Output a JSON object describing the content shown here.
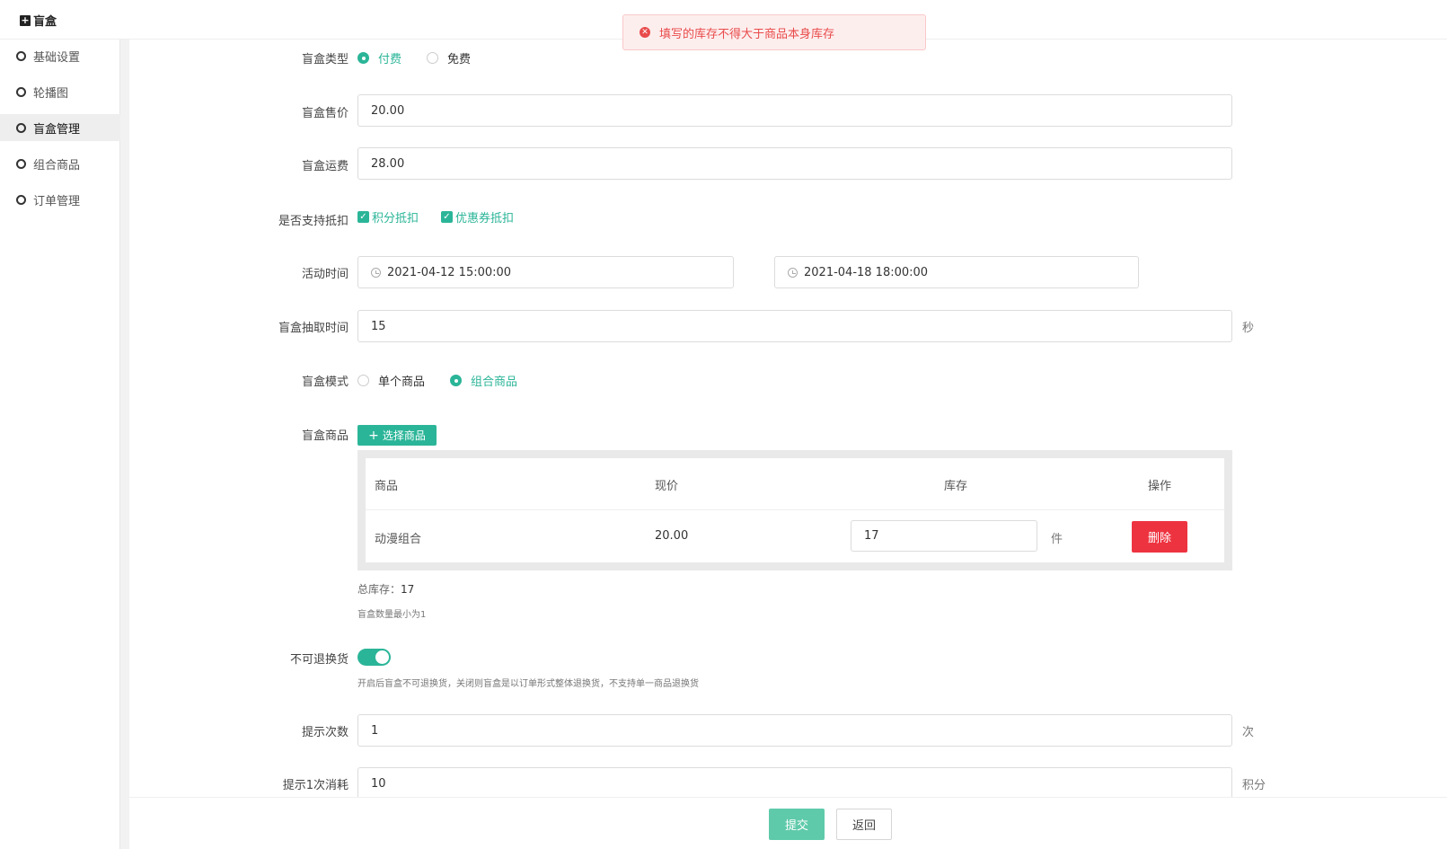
{
  "app": {
    "title": "盲盒"
  },
  "alert": {
    "message": "填写的库存不得大于商品本身库存",
    "color": "#e94b4b"
  },
  "sidebar": {
    "items": [
      {
        "label": "基础设置"
      },
      {
        "label": "轮播图"
      },
      {
        "label": "盲盒管理",
        "active": true
      },
      {
        "label": "组合商品"
      },
      {
        "label": "订单管理"
      }
    ]
  },
  "form": {
    "type": {
      "label": "盲盒类型",
      "options": [
        "付费",
        "免费"
      ],
      "selected": "付费"
    },
    "price": {
      "label": "盲盒售价",
      "value": "20.00"
    },
    "shipping": {
      "label": "盲盒运费",
      "value": "28.00"
    },
    "deduction": {
      "label": "是否支持抵扣",
      "options": [
        "积分抵扣",
        "优惠券抵扣"
      ]
    },
    "activity": {
      "label": "活动时间",
      "start": "2021-04-12 15:00:00",
      "end": "2021-04-18 18:00:00"
    },
    "draw_time": {
      "label": "盲盒抽取时间",
      "value": "15",
      "unit": "秒"
    },
    "mode": {
      "label": "盲盒模式",
      "options": [
        "单个商品",
        "组合商品"
      ],
      "selected": "组合商品"
    },
    "goods": {
      "label": "盲盒商品",
      "select_button": "选择商品",
      "columns": [
        "商品",
        "现价",
        "库存",
        "操作"
      ],
      "rows": [
        {
          "name": "动漫组合",
          "price": "20.00",
          "stock": "17",
          "unit": "件",
          "action": "删除"
        }
      ],
      "total_label": "总库存：",
      "total_value": "17",
      "hint": "盲盒数量最小为1"
    },
    "no_return": {
      "label": "不可退换货",
      "on": true,
      "hint": "开启后盲盒不可退换货，关闭则盲盒是以订单形式整体退换货，不支持单一商品退换货"
    },
    "hint_count": {
      "label": "提示次数",
      "value": "1",
      "unit": "次"
    },
    "hint_cost": {
      "label": "提示1次消耗",
      "value": "10",
      "unit": "积分"
    }
  },
  "footer": {
    "submit": "提交",
    "back": "返回"
  },
  "colors": {
    "accent": "#2bb598",
    "danger": "#ee3340"
  }
}
